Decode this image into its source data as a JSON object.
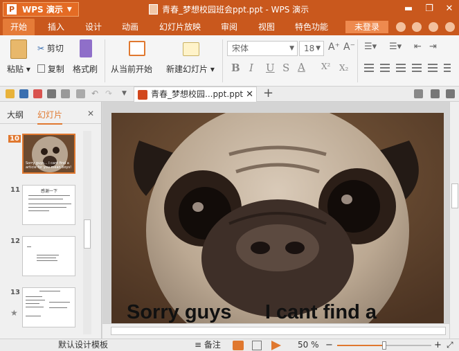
{
  "app": {
    "name": "WPS 演示",
    "logo_letter": "P",
    "document_title": "青春_梦想校园班会ppt.ppt - WPS 演示"
  },
  "menu": {
    "tabs": [
      "开始",
      "插入",
      "设计",
      "动画",
      "幻灯片放映",
      "审阅",
      "视图",
      "特色功能"
    ],
    "active": "开始",
    "login": "未登录"
  },
  "ribbon": {
    "paste": "粘贴",
    "cut": "剪切",
    "copy": "复制",
    "format_painter": "格式刷",
    "from_current": "从当前开始",
    "new_slide": "新建幻灯片",
    "font_name": "宋体",
    "font_size": "18",
    "format_buttons": [
      "B",
      "I",
      "U",
      "S",
      "A",
      "X²",
      "X₂"
    ]
  },
  "doc_tab": {
    "label": "青春_梦想校园...ppt.ppt",
    "close": "✕",
    "new": "+"
  },
  "panel": {
    "tabs": [
      "大纲",
      "幻灯片"
    ],
    "active": "幻灯片",
    "close": "✕",
    "slides": [
      {
        "num": "10",
        "caption": "Sorry guys... I cant find a article for you mean boys!"
      },
      {
        "num": "11",
        "title": "感谢一下"
      },
      {
        "num": "12"
      },
      {
        "num": "13"
      }
    ]
  },
  "slide": {
    "caption": "Sorry guys      I cant find a"
  },
  "status": {
    "template": "默认设计模板",
    "notes": "备注",
    "zoom": "50 %",
    "zoom_fraction": 0.5
  },
  "colors": {
    "accent": "#c9581d",
    "active_tab": "#e57b38",
    "login": "#ee8a4f",
    "selected_thumb": "#e0782f"
  }
}
